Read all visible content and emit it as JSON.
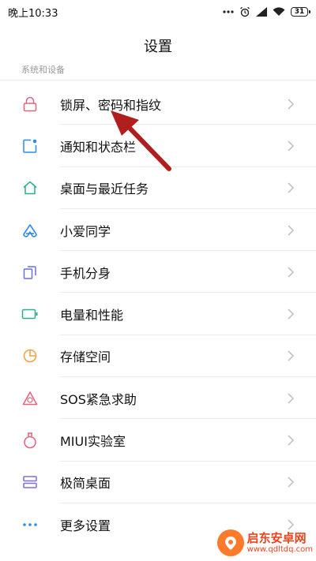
{
  "status_bar": {
    "time": "晚上10:33",
    "battery": "31",
    "icons": [
      "more-dots-icon",
      "alarm-icon",
      "signal-icon",
      "wifi-icon",
      "battery-icon"
    ]
  },
  "header": {
    "title": "设置"
  },
  "section": {
    "label": "系统和设备"
  },
  "settings": {
    "items": [
      {
        "label": "锁屏、密码和指纹",
        "icon": "lock-icon",
        "color": "#e0637a"
      },
      {
        "label": "通知和状态栏",
        "icon": "notification-icon",
        "color": "#2f8be8"
      },
      {
        "label": "桌面与最近任务",
        "icon": "home-icon",
        "color": "#27b08f"
      },
      {
        "label": "小爱同学",
        "icon": "xiaoai-icon",
        "color": "#2f8be8"
      },
      {
        "label": "手机分身",
        "icon": "dual-phone-icon",
        "color": "#6c6fe0"
      },
      {
        "label": "电量和性能",
        "icon": "battery-performance-icon",
        "color": "#27b08f"
      },
      {
        "label": "存储空间",
        "icon": "storage-pie-icon",
        "color": "#f0a040"
      },
      {
        "label": "SOS紧急求助",
        "icon": "sos-icon",
        "color": "#e0637a"
      },
      {
        "label": "MIUI实验室",
        "icon": "lab-flask-icon",
        "color": "#e0637a"
      },
      {
        "label": "极简桌面",
        "icon": "simple-desktop-icon",
        "color": "#7b6fe0"
      },
      {
        "label": "更多设置",
        "icon": "more-dots-icon",
        "color": "#2f8be8"
      }
    ]
  },
  "annotation": {
    "color": "#b01e1e"
  },
  "watermark": {
    "name": "启东安卓网",
    "url": "www.qdltdq.com"
  }
}
